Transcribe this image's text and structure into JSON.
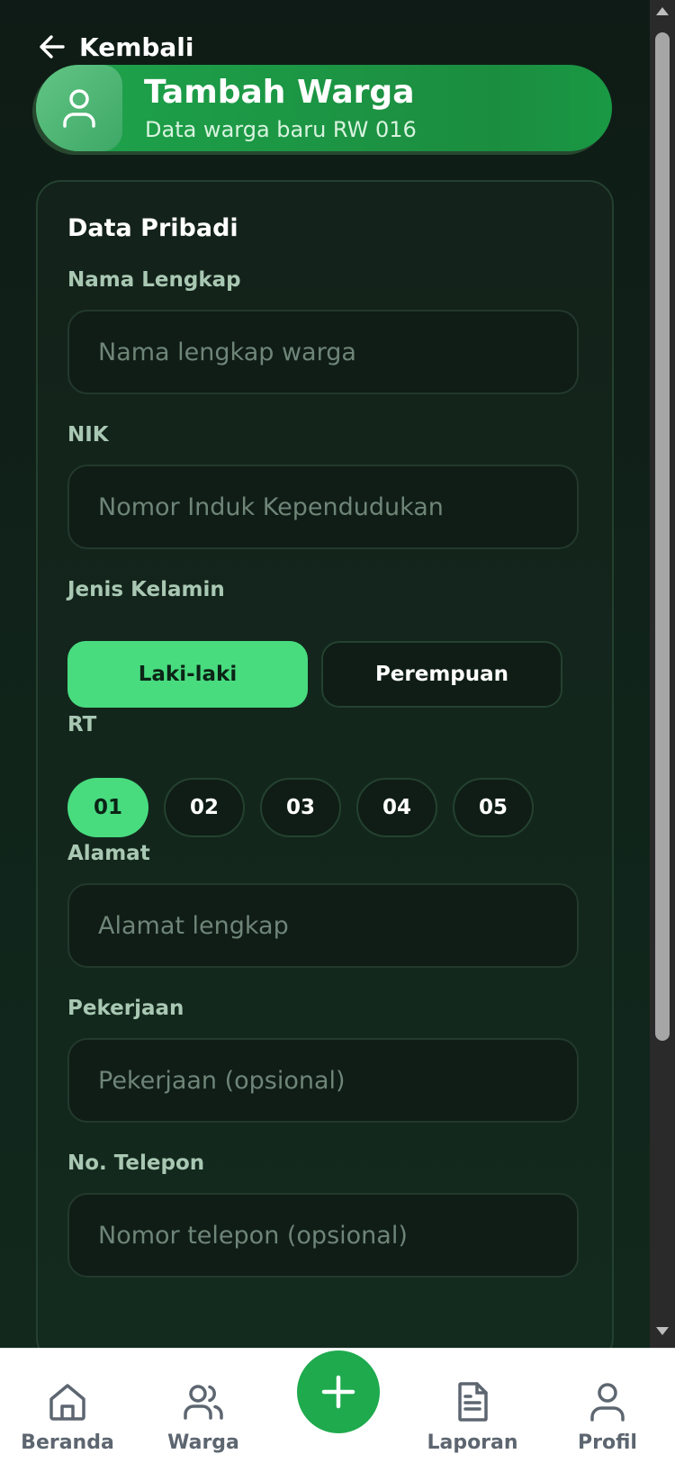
{
  "header": {
    "back_label": "Kembali",
    "title": "Tambah Warga",
    "subtitle": "Data warga baru RW 016"
  },
  "form": {
    "section_title": "Data Pribadi",
    "name": {
      "label": "Nama Lengkap",
      "placeholder": "Nama lengkap warga",
      "value": ""
    },
    "nik": {
      "label": "NIK",
      "placeholder": "Nomor Induk Kependudukan",
      "value": ""
    },
    "gender": {
      "label": "Jenis Kelamin",
      "options": [
        "Laki-laki",
        "Perempuan"
      ],
      "selected": "Laki-laki"
    },
    "rt": {
      "label": "RT",
      "options": [
        "01",
        "02",
        "03",
        "04",
        "05"
      ],
      "selected": "01"
    },
    "address": {
      "label": "Alamat",
      "placeholder": "Alamat lengkap",
      "value": ""
    },
    "job": {
      "label": "Pekerjaan",
      "placeholder": "Pekerjaan (opsional)",
      "value": ""
    },
    "phone": {
      "label": "No. Telepon",
      "placeholder": "Nomor telepon (opsional)",
      "value": ""
    }
  },
  "nav": {
    "items": [
      {
        "label": "Beranda",
        "icon": "home-icon"
      },
      {
        "label": "Warga",
        "icon": "users-icon"
      },
      {
        "label": "Laporan",
        "icon": "document-icon"
      },
      {
        "label": "Profil",
        "icon": "user-icon"
      }
    ],
    "fab_icon": "plus-icon"
  },
  "colors": {
    "accent": "#48dc7f",
    "primary_green": "#1eaa4d",
    "background": "#0f1b16"
  }
}
